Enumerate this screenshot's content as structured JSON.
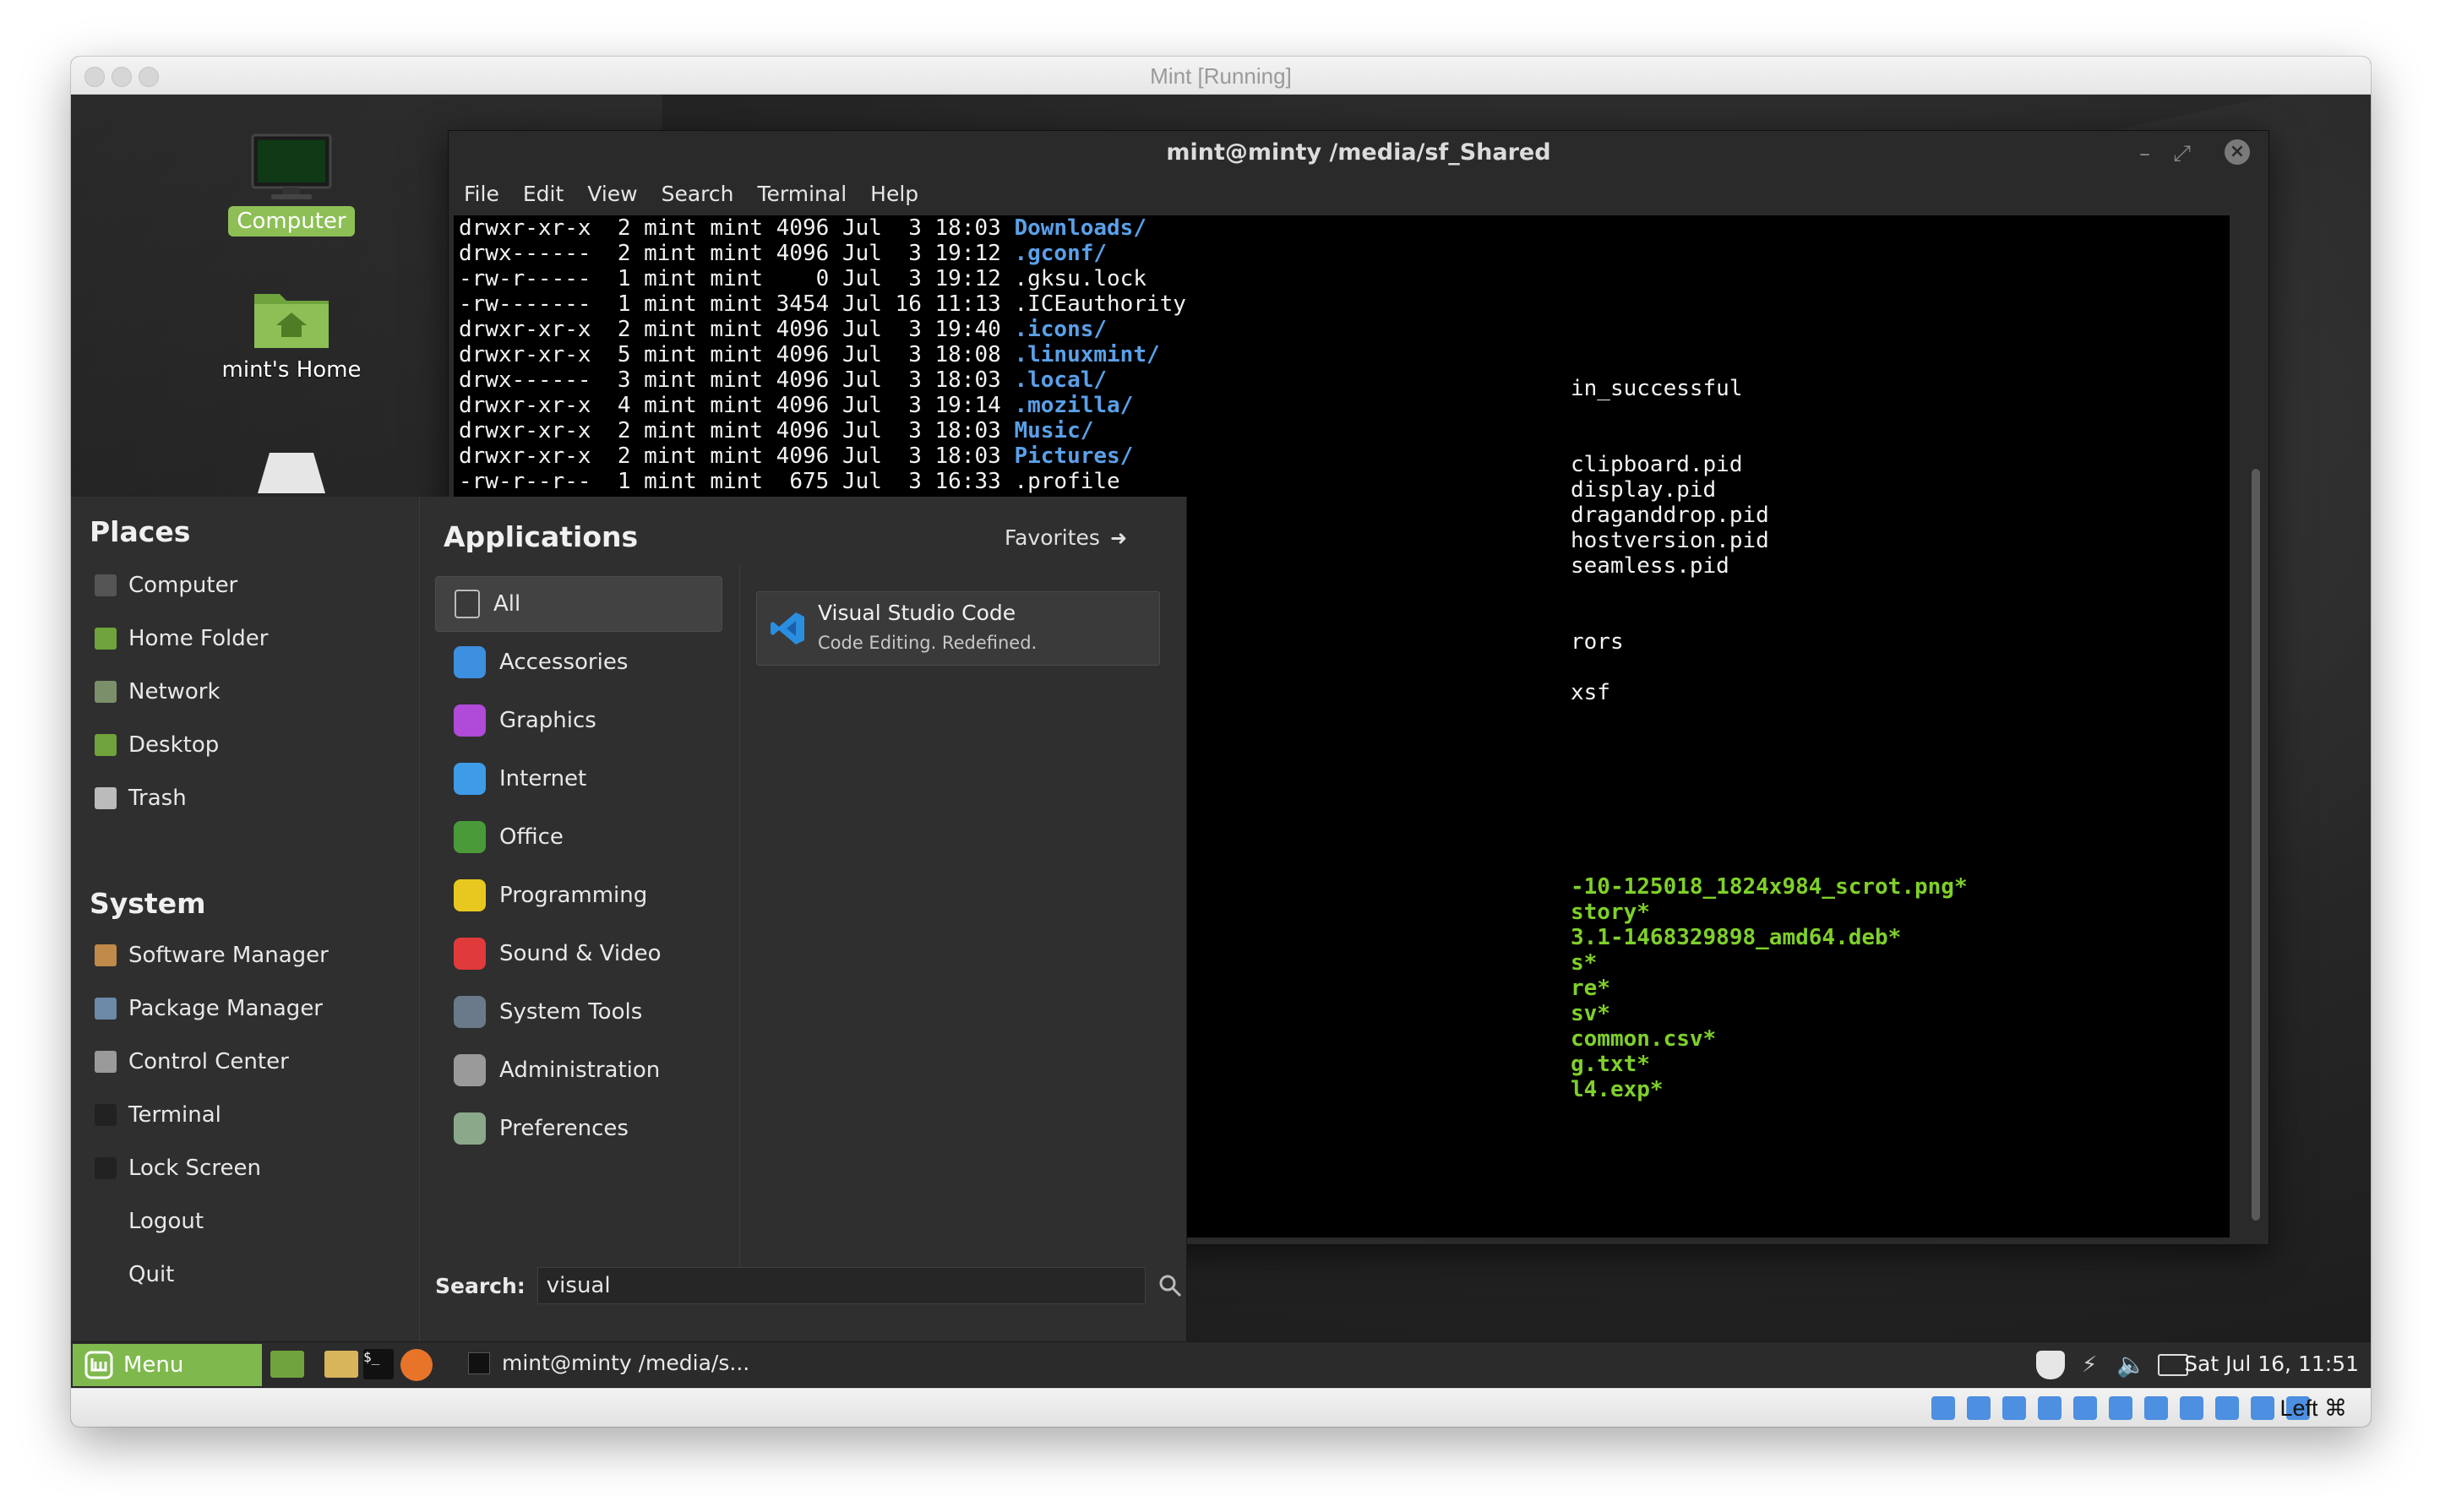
{
  "host": {
    "title": "Mint [Running]"
  },
  "desktop": {
    "icons": [
      {
        "label": "Computer"
      },
      {
        "label": "mint's Home"
      }
    ]
  },
  "terminal": {
    "title": "mint@minty /media/sf_Shared",
    "menu": [
      "File",
      "Edit",
      "View",
      "Search",
      "Terminal",
      "Help"
    ],
    "lines": [
      {
        "text": "drwxr-xr-x  2 mint mint 4096 Jul  3 18:03 ",
        "name": "Downloads/",
        "color": "blue"
      },
      {
        "text": "drwx------  2 mint mint 4096 Jul  3 19:12 ",
        "name": ".gconf/",
        "color": "blue"
      },
      {
        "text": "-rw-r-----  1 mint mint    0 Jul  3 19:12 ",
        "name": ".gksu.lock",
        "color": "plain"
      },
      {
        "text": "-rw-------  1 mint mint 3454 Jul 16 11:13 ",
        "name": ".ICEauthority",
        "color": "plain"
      },
      {
        "text": "drwxr-xr-x  2 mint mint 4096 Jul  3 19:40 ",
        "name": ".icons/",
        "color": "blue"
      },
      {
        "text": "drwxr-xr-x  5 mint mint 4096 Jul  3 18:08 ",
        "name": ".linuxmint/",
        "color": "blue"
      },
      {
        "text": "drwx------  3 mint mint 4096 Jul  3 18:03 ",
        "name": ".local/",
        "color": "blue"
      },
      {
        "text": "drwxr-xr-x  4 mint mint 4096 Jul  3 19:14 ",
        "name": ".mozilla/",
        "color": "blue"
      },
      {
        "text": "drwxr-xr-x  2 mint mint 4096 Jul  3 18:03 ",
        "name": "Music/",
        "color": "blue"
      },
      {
        "text": "drwxr-xr-x  2 mint mint 4096 Jul  3 18:03 ",
        "name": "Pictures/",
        "color": "blue"
      },
      {
        "text": "-rw-r--r--  1 mint mint  675 Jul  3 16:33 ",
        "name": ".profile",
        "color": "plain"
      }
    ],
    "partial_lines": [
      {
        "text": "in_successful",
        "color": "plain"
      },
      {
        "text": "clipboard.pid",
        "color": "plain"
      },
      {
        "text": "display.pid",
        "color": "plain"
      },
      {
        "text": "draganddrop.pid",
        "color": "plain"
      },
      {
        "text": "hostversion.pid",
        "color": "plain"
      },
      {
        "text": "seamless.pid",
        "color": "plain"
      },
      {
        "text": "rors",
        "color": "plain"
      },
      {
        "text": "xsf",
        "color": "plain"
      },
      {
        "text": "-10-125018_1824x984_scrot.png*",
        "color": "green"
      },
      {
        "text": "story*",
        "color": "green"
      },
      {
        "text": "3.1-1468329898_amd64.deb*",
        "color": "green"
      },
      {
        "text": "s*",
        "color": "green"
      },
      {
        "text": "re*",
        "color": "green"
      },
      {
        "text": "sv*",
        "color": "green"
      },
      {
        "text": "common.csv*",
        "color": "green"
      },
      {
        "text": "g.txt*",
        "color": "green"
      },
      {
        "text": "l4.exp*",
        "color": "green"
      }
    ]
  },
  "menu": {
    "places_title": "Places",
    "places": [
      {
        "label": "Computer",
        "icon": "computer-icon",
        "color": "#555555"
      },
      {
        "label": "Home Folder",
        "icon": "home-folder-icon",
        "color": "#6fa33b"
      },
      {
        "label": "Network",
        "icon": "network-icon",
        "color": "#7a8f6a"
      },
      {
        "label": "Desktop",
        "icon": "desktop-icon",
        "color": "#6fa33b"
      },
      {
        "label": "Trash",
        "icon": "trash-icon",
        "color": "#bbbbbb"
      }
    ],
    "system_title": "System",
    "system": [
      {
        "label": "Software Manager",
        "icon": "software-manager-icon",
        "color": "#c08a4a"
      },
      {
        "label": "Package Manager",
        "icon": "package-manager-icon",
        "color": "#6a8aa8"
      },
      {
        "label": "Control Center",
        "icon": "control-center-icon",
        "color": "#9a9a9a"
      },
      {
        "label": "Terminal",
        "icon": "terminal-icon",
        "color": "#222222"
      },
      {
        "label": "Lock Screen",
        "icon": "lock-icon",
        "color": "#222222"
      },
      {
        "label": "Logout",
        "icon": "logout-icon",
        "color": "#2f2f2f"
      },
      {
        "label": "Quit",
        "icon": "quit-icon",
        "color": "#2f2f2f"
      }
    ],
    "apps_title": "Applications",
    "favorites_label": "Favorites",
    "categories": [
      {
        "label": "All",
        "icon": "all-icon",
        "color": "#3a3a3a"
      },
      {
        "label": "Accessories",
        "icon": "accessories-icon",
        "color": "#3d8fe0"
      },
      {
        "label": "Graphics",
        "icon": "graphics-icon",
        "color": "#b04ad8"
      },
      {
        "label": "Internet",
        "icon": "internet-icon",
        "color": "#3d9be8"
      },
      {
        "label": "Office",
        "icon": "office-icon",
        "color": "#4a9a3a"
      },
      {
        "label": "Programming",
        "icon": "programming-icon",
        "color": "#e8c81e"
      },
      {
        "label": "Sound & Video",
        "icon": "sound-video-icon",
        "color": "#e03a3a"
      },
      {
        "label": "System Tools",
        "icon": "system-tools-icon",
        "color": "#6a7a8a"
      },
      {
        "label": "Administration",
        "icon": "administration-icon",
        "color": "#9a9a9a"
      },
      {
        "label": "Preferences",
        "icon": "preferences-icon",
        "color": "#8aa88a"
      }
    ],
    "result": {
      "name": "Visual Studio Code",
      "description": "Code Editing. Redefined."
    },
    "search_label": "Search:",
    "search_value": "visual"
  },
  "panel": {
    "menu_label": "Menu",
    "task_label": "mint@minty /media/s...",
    "clock": "Sat Jul 16, 11:51"
  },
  "vbox": {
    "host_key": "Left ⌘"
  }
}
